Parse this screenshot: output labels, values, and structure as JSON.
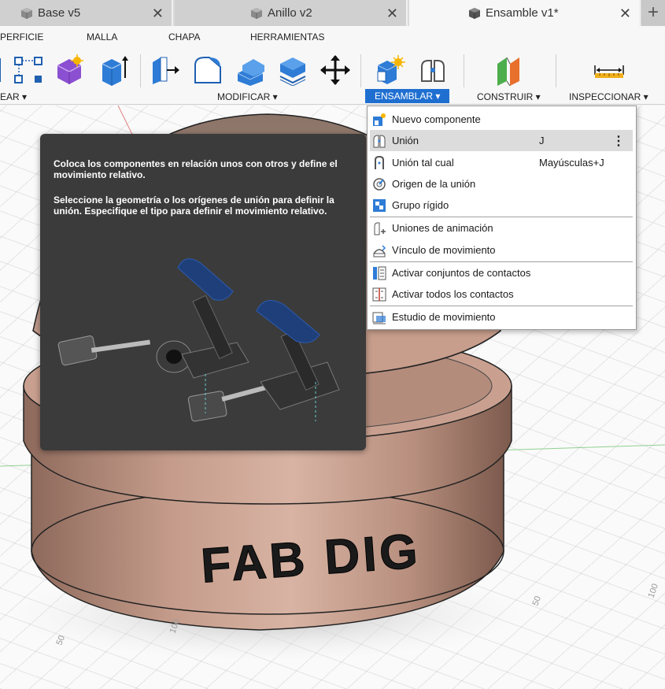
{
  "tabs": [
    {
      "label": "Base v5",
      "close": "✕"
    },
    {
      "label": "Anillo v2",
      "close": "✕"
    },
    {
      "label": "Ensamble v1*",
      "close": "✕"
    }
  ],
  "tab_add": "+",
  "ribbon": {
    "tabs": [
      "PERFICIE",
      "MALLA",
      "CHAPA",
      "HERRAMIENTAS"
    ],
    "groups": {
      "crear": "EAR ▾",
      "modificar": "MODIFICAR ▾",
      "ensamblar": "ENSAMBLAR ▾",
      "construir": "CONSTRUIR ▾",
      "inspeccionar": "INSPECCIONAR ▾"
    }
  },
  "tooltip": {
    "line1": "Coloca los componentes en relación unos con otros y define el movimiento relativo.",
    "line2": "Seleccione la geometría o los orígenes de unión para definir la unión. Especifique el tipo para definir el movimiento relativo."
  },
  "menu": {
    "items": [
      {
        "label": "Nuevo componente",
        "shortcut": ""
      },
      {
        "label": "Unión",
        "shortcut": "J"
      },
      {
        "label": "Unión tal cual",
        "shortcut": "Mayúsculas+J"
      },
      {
        "label": "Origen de la unión",
        "shortcut": ""
      },
      {
        "label": "Grupo rígido",
        "shortcut": ""
      },
      {
        "label": "Uniones de animación",
        "shortcut": ""
      },
      {
        "label": "Vínculo de movimiento",
        "shortcut": ""
      },
      {
        "label": "Activar conjuntos de contactos",
        "shortcut": ""
      },
      {
        "label": "Activar todos los contactos",
        "shortcut": ""
      },
      {
        "label": "Estudio de movimiento",
        "shortcut": ""
      }
    ],
    "more": "⋮"
  },
  "model": {
    "engraving": "FAB DIG",
    "grid_labels": [
      "100",
      "50",
      "100",
      "50"
    ]
  },
  "colors": {
    "accent": "#1f6fd1",
    "copper": "#b88f7e",
    "tooltip_bg": "#3b3b3b"
  }
}
